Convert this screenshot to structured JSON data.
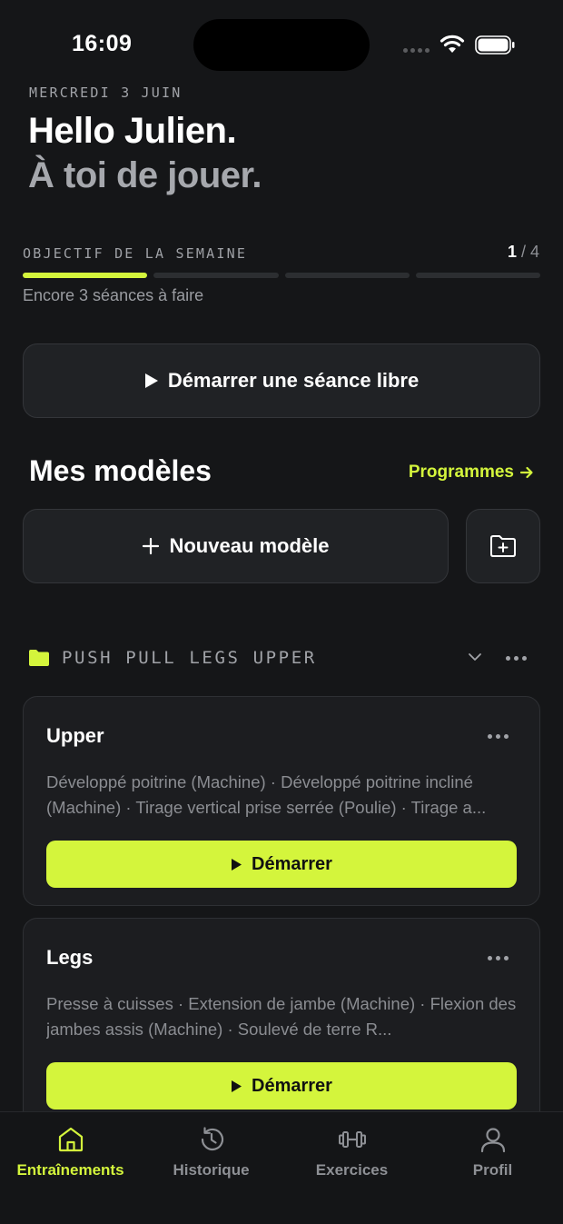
{
  "status_bar": {
    "time": "16:09"
  },
  "header": {
    "date": "MERCREDI 3 JUIN",
    "greeting": "Hello Julien.",
    "subgreeting": "À toi de jouer."
  },
  "weekly_goal": {
    "label": "OBJECTIF DE LA SEMAINE",
    "done": "1",
    "separator": " / ",
    "total": "4",
    "remaining_text": "Encore 3 séances à faire",
    "progress_fraction": 0.25
  },
  "free_session": {
    "label": "Démarrer une séance libre",
    "icon": "play-icon"
  },
  "templates": {
    "title": "Mes modèles",
    "programs_link": "Programmes",
    "new_template_label": "Nouveau modèle",
    "new_folder_icon": "folder-plus-icon"
  },
  "folder": {
    "name": "PUSH PULL LEGS UPPER",
    "icon": "folder-icon",
    "color": "#d4f53c"
  },
  "cards": [
    {
      "title": "Upper",
      "description": "Développé poitrine (Machine) · Développé poitrine incliné (Machine) · Tirage vertical prise serrée (Poulie) · Tirage a...",
      "start_label": "Démarrer"
    },
    {
      "title": "Legs",
      "description": "Presse à cuisses · Extension de jambe (Machine) · Flexion des jambes assis (Machine) · Soulevé de terre R...",
      "start_label": "Démarrer"
    }
  ],
  "tab_bar": {
    "tabs": [
      {
        "label": "Entraînements",
        "icon": "home-icon",
        "active": true
      },
      {
        "label": "Historique",
        "icon": "history-icon",
        "active": false
      },
      {
        "label": "Exercices",
        "icon": "dumbbell-icon",
        "active": false
      },
      {
        "label": "Profil",
        "icon": "user-icon",
        "active": false
      }
    ]
  },
  "colors": {
    "accent": "#d4f53c",
    "background": "#151618",
    "card": "#1c1d20"
  }
}
